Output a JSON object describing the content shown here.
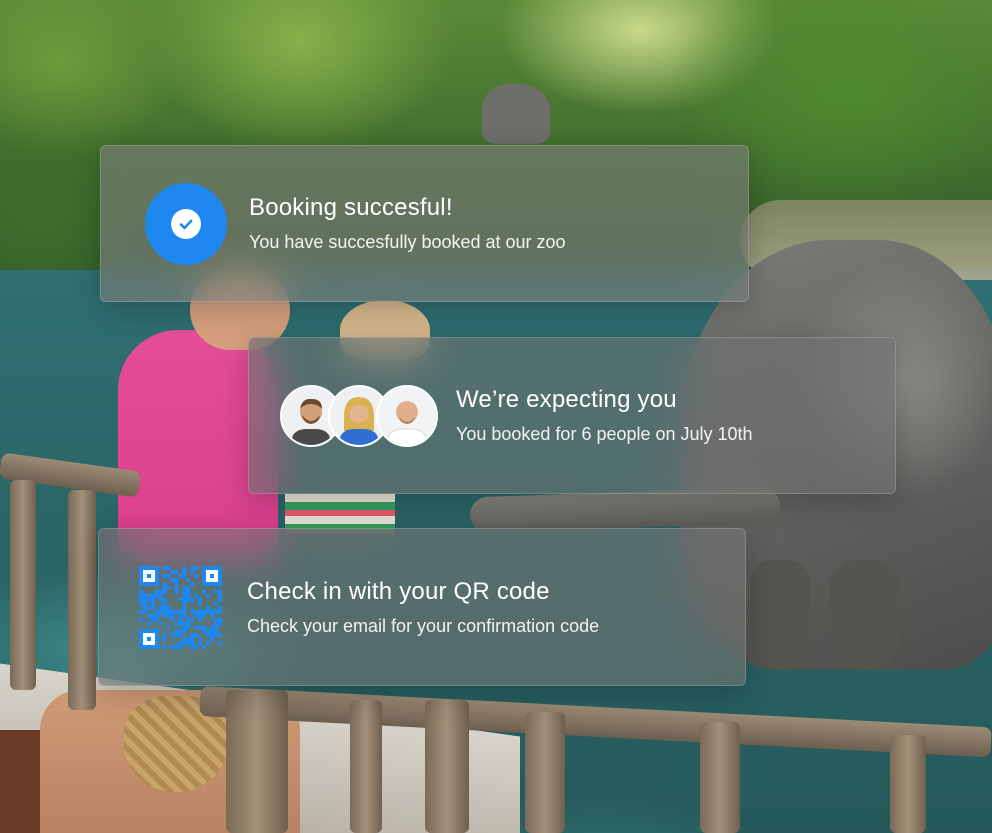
{
  "colors": {
    "accent_blue": "#1e88f0",
    "card_text": "#ffffff",
    "qr_blue": "#1e88f0"
  },
  "notifications": [
    {
      "icon": "check-icon",
      "title": "Booking succesful!",
      "subtitle": "You have succesfully booked at our zoo"
    },
    {
      "icon": "avatar-group",
      "avatars": [
        "man-with-beard-avatar",
        "blonde-woman-avatar",
        "bald-man-avatar"
      ],
      "title": "We’re expecting you",
      "subtitle": "You booked for 6 people on July 10th"
    },
    {
      "icon": "qr-code-icon",
      "title": "Check in with your QR code",
      "subtitle": "Check your email for your confirmation code"
    }
  ]
}
